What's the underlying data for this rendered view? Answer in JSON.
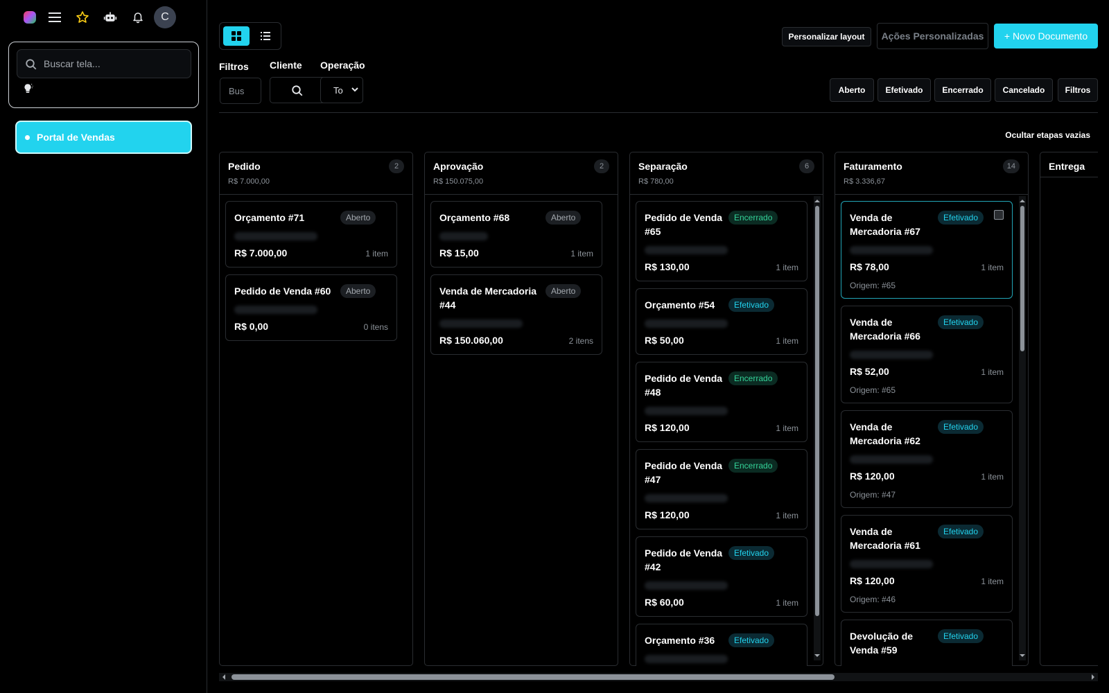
{
  "sidebar": {
    "avatar_letter": "C",
    "search_placeholder": "Buscar tela...",
    "nav": [
      {
        "label": "Portal de Vendas",
        "active": true
      }
    ]
  },
  "toolbar": {
    "personalizar_layout": "Personalizar layout",
    "acoes_personalizadas": "Ações Personalizadas",
    "novo_documento": "+ Novo Documento"
  },
  "filters": {
    "filtros_label": "Filtros",
    "cliente_label": "Cliente",
    "operacao_label": "Operação",
    "search_value": "Bus",
    "operacao_value": "To",
    "status_buttons": [
      "Aberto",
      "Efetivado",
      "Encerrado",
      "Cancelado"
    ],
    "filtros_button": "Filtros",
    "ocultar_etapas": "Ocultar etapas vazias"
  },
  "accent_color": "#22d3ee",
  "columns": [
    {
      "title": "Pedido",
      "total": "R$ 7.000,00",
      "count": "2",
      "cards": [
        {
          "title": "Orçamento #71",
          "status": "Aberto",
          "value": "R$ 7.000,00",
          "items": "1 item"
        },
        {
          "title": "Pedido de Venda #60",
          "status": "Aberto",
          "value": "R$ 0,00",
          "items": "0 itens"
        }
      ]
    },
    {
      "title": "Aprovação",
      "total": "R$ 150.075,00",
      "count": "2",
      "cards": [
        {
          "title": "Orçamento #68",
          "status": "Aberto",
          "value": "R$ 15,00",
          "items": "1 item"
        },
        {
          "title": "Venda de Mercadoria #44",
          "status": "Aberto",
          "value": "R$ 150.060,00",
          "items": "2 itens"
        }
      ]
    },
    {
      "title": "Separação",
      "total": "R$ 780,00",
      "count": "6",
      "cards": [
        {
          "title": "Pedido de Venda #65",
          "status": "Encerrado",
          "value": "R$ 130,00",
          "items": "1 item"
        },
        {
          "title": "Orçamento #54",
          "status": "Efetivado",
          "value": "R$ 50,00",
          "items": "1 item"
        },
        {
          "title": "Pedido de Venda #48",
          "status": "Encerrado",
          "value": "R$ 120,00",
          "items": "1 item"
        },
        {
          "title": "Pedido de Venda #47",
          "status": "Encerrado",
          "value": "R$ 120,00",
          "items": "1 item"
        },
        {
          "title": "Pedido de Venda #42",
          "status": "Efetivado",
          "value": "R$ 60,00",
          "items": "1 item"
        },
        {
          "title": "Orçamento #36",
          "status": "Efetivado",
          "value": "",
          "items": ""
        }
      ]
    },
    {
      "title": "Faturamento",
      "total": "R$ 3.336,67",
      "count": "14",
      "cards": [
        {
          "title": "Venda de Mercadoria #67",
          "status": "Efetivado",
          "value": "R$ 78,00",
          "items": "1 item",
          "origin": "Origem: #65",
          "checkbox": true
        },
        {
          "title": "Venda de Mercadoria #66",
          "status": "Efetivado",
          "value": "R$ 52,00",
          "items": "1 item",
          "origin": "Origem: #65"
        },
        {
          "title": "Venda de Mercadoria #62",
          "status": "Efetivado",
          "value": "R$ 120,00",
          "items": "1 item",
          "origin": "Origem: #47"
        },
        {
          "title": "Venda de Mercadoria #61",
          "status": "Efetivado",
          "value": "R$ 120,00",
          "items": "1 item",
          "origin": "Origem: #46"
        },
        {
          "title": "Devolução de Venda #59",
          "status": "Efetivado",
          "value": "",
          "items": ""
        }
      ]
    },
    {
      "title": "Entrega",
      "total": "",
      "count": "",
      "cards": []
    }
  ]
}
